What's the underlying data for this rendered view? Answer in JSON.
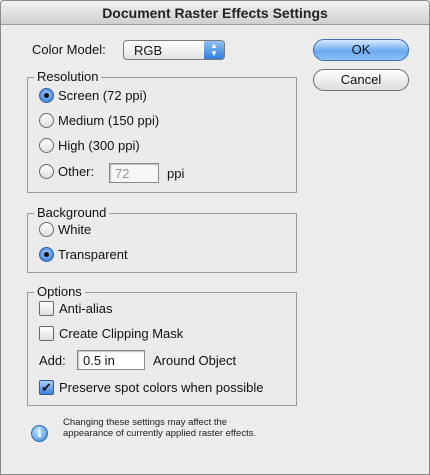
{
  "window": {
    "title": "Document Raster Effects Settings"
  },
  "color_model": {
    "label": "Color Model:",
    "value": "RGB"
  },
  "buttons": {
    "ok": "OK",
    "cancel": "Cancel"
  },
  "resolution": {
    "legend": "Resolution",
    "options": [
      "Screen (72 ppi)",
      "Medium (150 ppi)",
      "High (300 ppi)",
      "Other:"
    ],
    "selected": "Screen (72 ppi)",
    "other_value": "72",
    "other_unit": "ppi"
  },
  "background": {
    "legend": "Background",
    "options": [
      "White",
      "Transparent"
    ],
    "selected": "Transparent"
  },
  "options": {
    "legend": "Options",
    "anti_alias": {
      "label": "Anti-alias",
      "checked": false
    },
    "clipping_mask": {
      "label": "Create Clipping Mask",
      "checked": false
    },
    "add": {
      "label": "Add:",
      "value": "0.5 in",
      "suffix": "Around Object"
    },
    "preserve_spot": {
      "label": "Preserve spot colors when possible",
      "checked": true
    }
  },
  "info": {
    "icon": "info-icon",
    "text": "Changing these settings may affect the appearance of currently applied raster effects."
  }
}
